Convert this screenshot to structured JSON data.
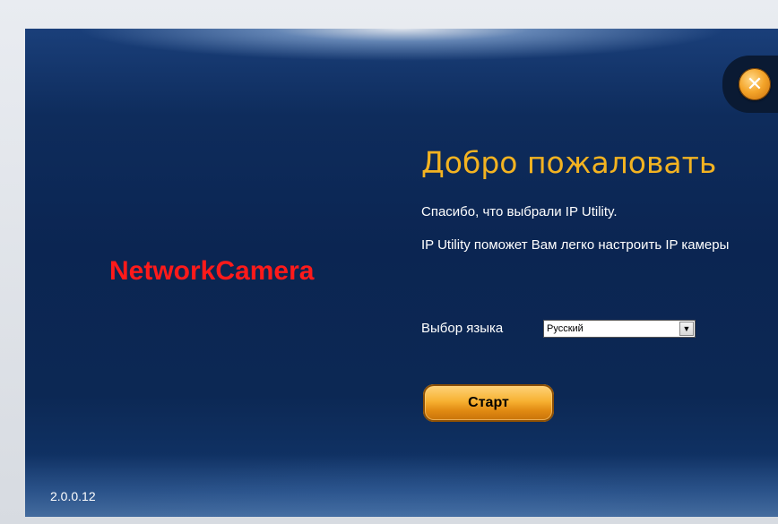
{
  "app": {
    "brand": "NetworkCamera",
    "version": "2.0.0.12"
  },
  "welcome": {
    "title": "Добро пожаловать",
    "line1": "Спасибо, что выбрали IP Utility.",
    "line2": "IP Utility поможет Вам легко настроить IP камеры"
  },
  "language": {
    "label": "Выбор языка",
    "selected": "Русский"
  },
  "actions": {
    "start_label": "Старт",
    "close_glyph": "✕"
  },
  "icons": {
    "close": "close-icon",
    "dropdown": "chevron-down-icon"
  },
  "colors": {
    "title": "#f3b321",
    "brand": "#ff1a1a",
    "button": "#f7b132",
    "background": "#0b2552"
  }
}
